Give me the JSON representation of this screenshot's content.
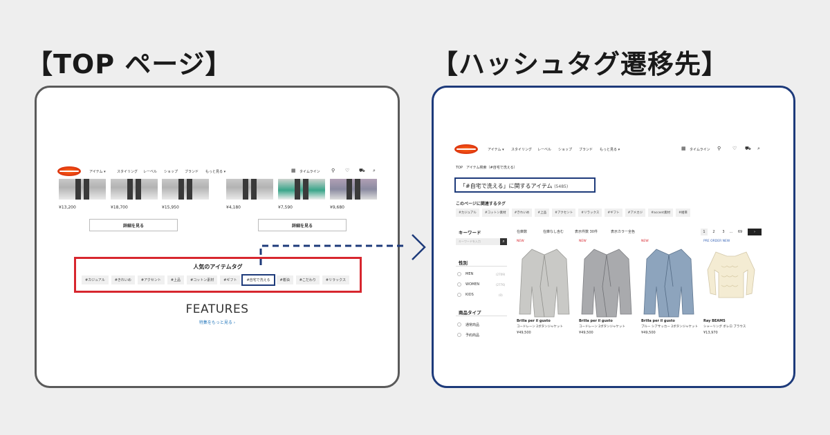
{
  "titles": {
    "left": "【TOP ページ】",
    "right": "【ハッシュタグ遷移先】"
  },
  "header": {
    "nav": [
      "アイテム ▾",
      "スタイリング",
      "レーベル",
      "ショップ",
      "ブランド",
      "もっと見る ▾"
    ],
    "timeline": "タイムライン"
  },
  "top_page": {
    "prices": [
      "¥13,200",
      "¥18,700",
      "¥15,950",
      "¥4,180",
      "¥7,590",
      "¥9,680"
    ],
    "detail_button": "詳細を見る",
    "tag_section_title": "人気のアイテムタグ",
    "tags": [
      "#カジュアル",
      "#きれいめ",
      "#アクセント",
      "#上品",
      "#コットン素材",
      "#ギフト",
      "#自宅で洗える",
      "#着油",
      "#こだわり",
      "#リラックス"
    ],
    "highlighted_tag_index": 6,
    "features_heading": "FEATURES",
    "features_link": "特集をもっと見る ›"
  },
  "result_page": {
    "breadcrumb": "TOP　アイテム検索（#自宅で洗える）",
    "title": "「#自宅で洗える」に関するアイテム",
    "count": "(5485)",
    "related_tags_heading": "このページに関連するタグ",
    "related_tags": [
      "#カジュアル",
      "#コットン素材",
      "#きれいめ",
      "#上品",
      "#アクセント",
      "#リラックス",
      "#ギフト",
      "#アメカジ",
      "#accent素材",
      "#紺目"
    ],
    "keyword_heading": "キーワード",
    "keyword_placeholder": "キーワードを入力",
    "gender_heading": "性別",
    "genders": [
      {
        "label": "MEN",
        "count": "(2709)"
      },
      {
        "label": "WOMEN",
        "count": "(2776)"
      },
      {
        "label": "KIDS",
        "count": "(0)"
      }
    ],
    "type_heading": "商品タイプ",
    "types": [
      "通常商品",
      "予約商品"
    ],
    "filters": [
      "在庫数",
      "在庫なし含む",
      "表示件数 30件",
      "表示カラー全色"
    ],
    "pages": [
      "1",
      "2",
      "3",
      "…",
      "69",
      "›"
    ],
    "products": [
      {
        "badge": "NEW",
        "brand": "Brilla per il gusto",
        "name": "コードレーン 2ボタンジャケット",
        "price": "¥49,500",
        "color": "#c9c9c6"
      },
      {
        "badge": "NEW",
        "brand": "Brilla per il gusto",
        "name": "コードレーン 2ボタンジャケット",
        "price": "¥49,500",
        "color": "#a9aaad"
      },
      {
        "badge": "NEW",
        "brand": "Brilla per il gusto",
        "name": "ブルー シアサッカー 2ボタンジャケット",
        "price": "¥49,500",
        "color": "#8da4bd"
      },
      {
        "badge": "PRE ORDER NEW",
        "brand": "Ray BEAMS",
        "name": "シャーリング ボレロ ブラウス",
        "price": "¥13,970",
        "color": "#f4ecd3"
      }
    ]
  }
}
